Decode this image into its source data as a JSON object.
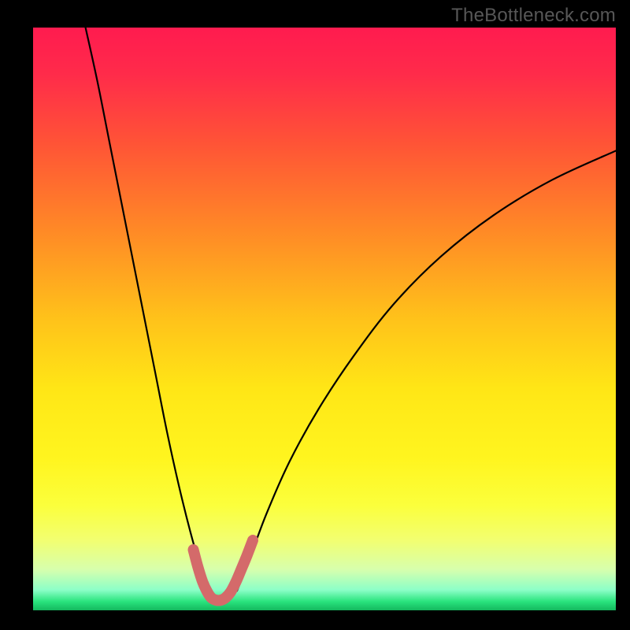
{
  "watermark": "TheBottleneck.com",
  "chart_data": {
    "type": "line",
    "title": "",
    "xlabel": "",
    "ylabel": "",
    "xlim": [
      0,
      100
    ],
    "ylim": [
      0,
      100
    ],
    "background_gradient": {
      "stops": [
        {
          "pos": 0.0,
          "color": "#ff1b4f"
        },
        {
          "pos": 0.08,
          "color": "#ff2b4a"
        },
        {
          "pos": 0.2,
          "color": "#ff5436"
        },
        {
          "pos": 0.35,
          "color": "#ff8a26"
        },
        {
          "pos": 0.5,
          "color": "#ffc21a"
        },
        {
          "pos": 0.62,
          "color": "#ffe616"
        },
        {
          "pos": 0.74,
          "color": "#fff51f"
        },
        {
          "pos": 0.82,
          "color": "#fbff3c"
        },
        {
          "pos": 0.88,
          "color": "#f2ff71"
        },
        {
          "pos": 0.93,
          "color": "#d7ffad"
        },
        {
          "pos": 0.965,
          "color": "#8cffc8"
        },
        {
          "pos": 0.985,
          "color": "#29e37d"
        },
        {
          "pos": 1.0,
          "color": "#14b85e"
        }
      ]
    },
    "series": [
      {
        "name": "bottleneck-curve-left",
        "color": "#000000",
        "width": 2.2,
        "x": [
          9.0,
          11.0,
          13.0,
          15.0,
          17.0,
          19.0,
          21.0,
          23.0,
          25.0,
          27.0,
          29.0,
          30.0
        ],
        "y": [
          100.0,
          91.0,
          81.0,
          71.0,
          61.0,
          51.0,
          41.0,
          31.0,
          22.0,
          14.0,
          7.0,
          4.0
        ]
      },
      {
        "name": "bottleneck-curve-right",
        "color": "#000000",
        "width": 2.2,
        "x": [
          35.0,
          37.0,
          40.0,
          44.0,
          49.0,
          55.0,
          62.0,
          70.0,
          79.0,
          89.0,
          100.0
        ],
        "y": [
          4.0,
          9.0,
          17.0,
          26.0,
          35.0,
          44.0,
          53.0,
          61.0,
          68.0,
          74.0,
          79.0
        ]
      },
      {
        "name": "optimal-zone-marker",
        "color": "#d46a6a",
        "width": 14,
        "linecap": "round",
        "x": [
          27.5,
          28.3,
          29.1,
          29.9,
          30.6,
          31.4,
          32.2,
          33.0,
          33.9,
          34.8,
          35.7,
          36.7,
          37.7
        ],
        "y": [
          11.0,
          8.0,
          5.5,
          3.8,
          2.8,
          2.4,
          2.4,
          2.8,
          3.8,
          5.5,
          7.6,
          10.0,
          12.6
        ]
      }
    ]
  }
}
